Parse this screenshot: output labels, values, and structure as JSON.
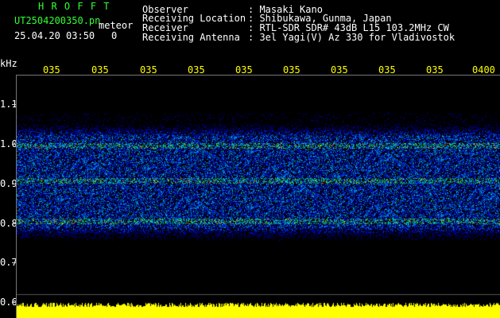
{
  "header": {
    "station": "H R O F F T",
    "filename": "UT2504200350.pn",
    "meteor_label": "meteor",
    "datetime": "25.04.20 03:50",
    "meteor_count": "0",
    "info_labels": [
      "Observer",
      "Receiving Location",
      "Receiver",
      "Receiving Antenna"
    ],
    "info_values": [
      ": Masaki Kano",
      ": Shibukawa, Gunma, Japan",
      ": RTL-SDR SDR# 43dB L15 103.2MHz CW",
      ": 3el Yagi(V) Az 330 for Vladivostok"
    ]
  },
  "axis": {
    "y_unit": "kHz",
    "y_ticks": [
      "1.1",
      "1.0",
      "0.9",
      "0.8",
      "0.7",
      "0.6"
    ],
    "x_ticks": [
      "035",
      "035",
      "035",
      "035",
      "035",
      "035",
      "035",
      "035",
      "035",
      "0400"
    ]
  },
  "colors": {
    "background": "#000000",
    "header_green": "#33ff33",
    "label_yellow": "#ffff00",
    "text_white": "#ffffff"
  }
}
